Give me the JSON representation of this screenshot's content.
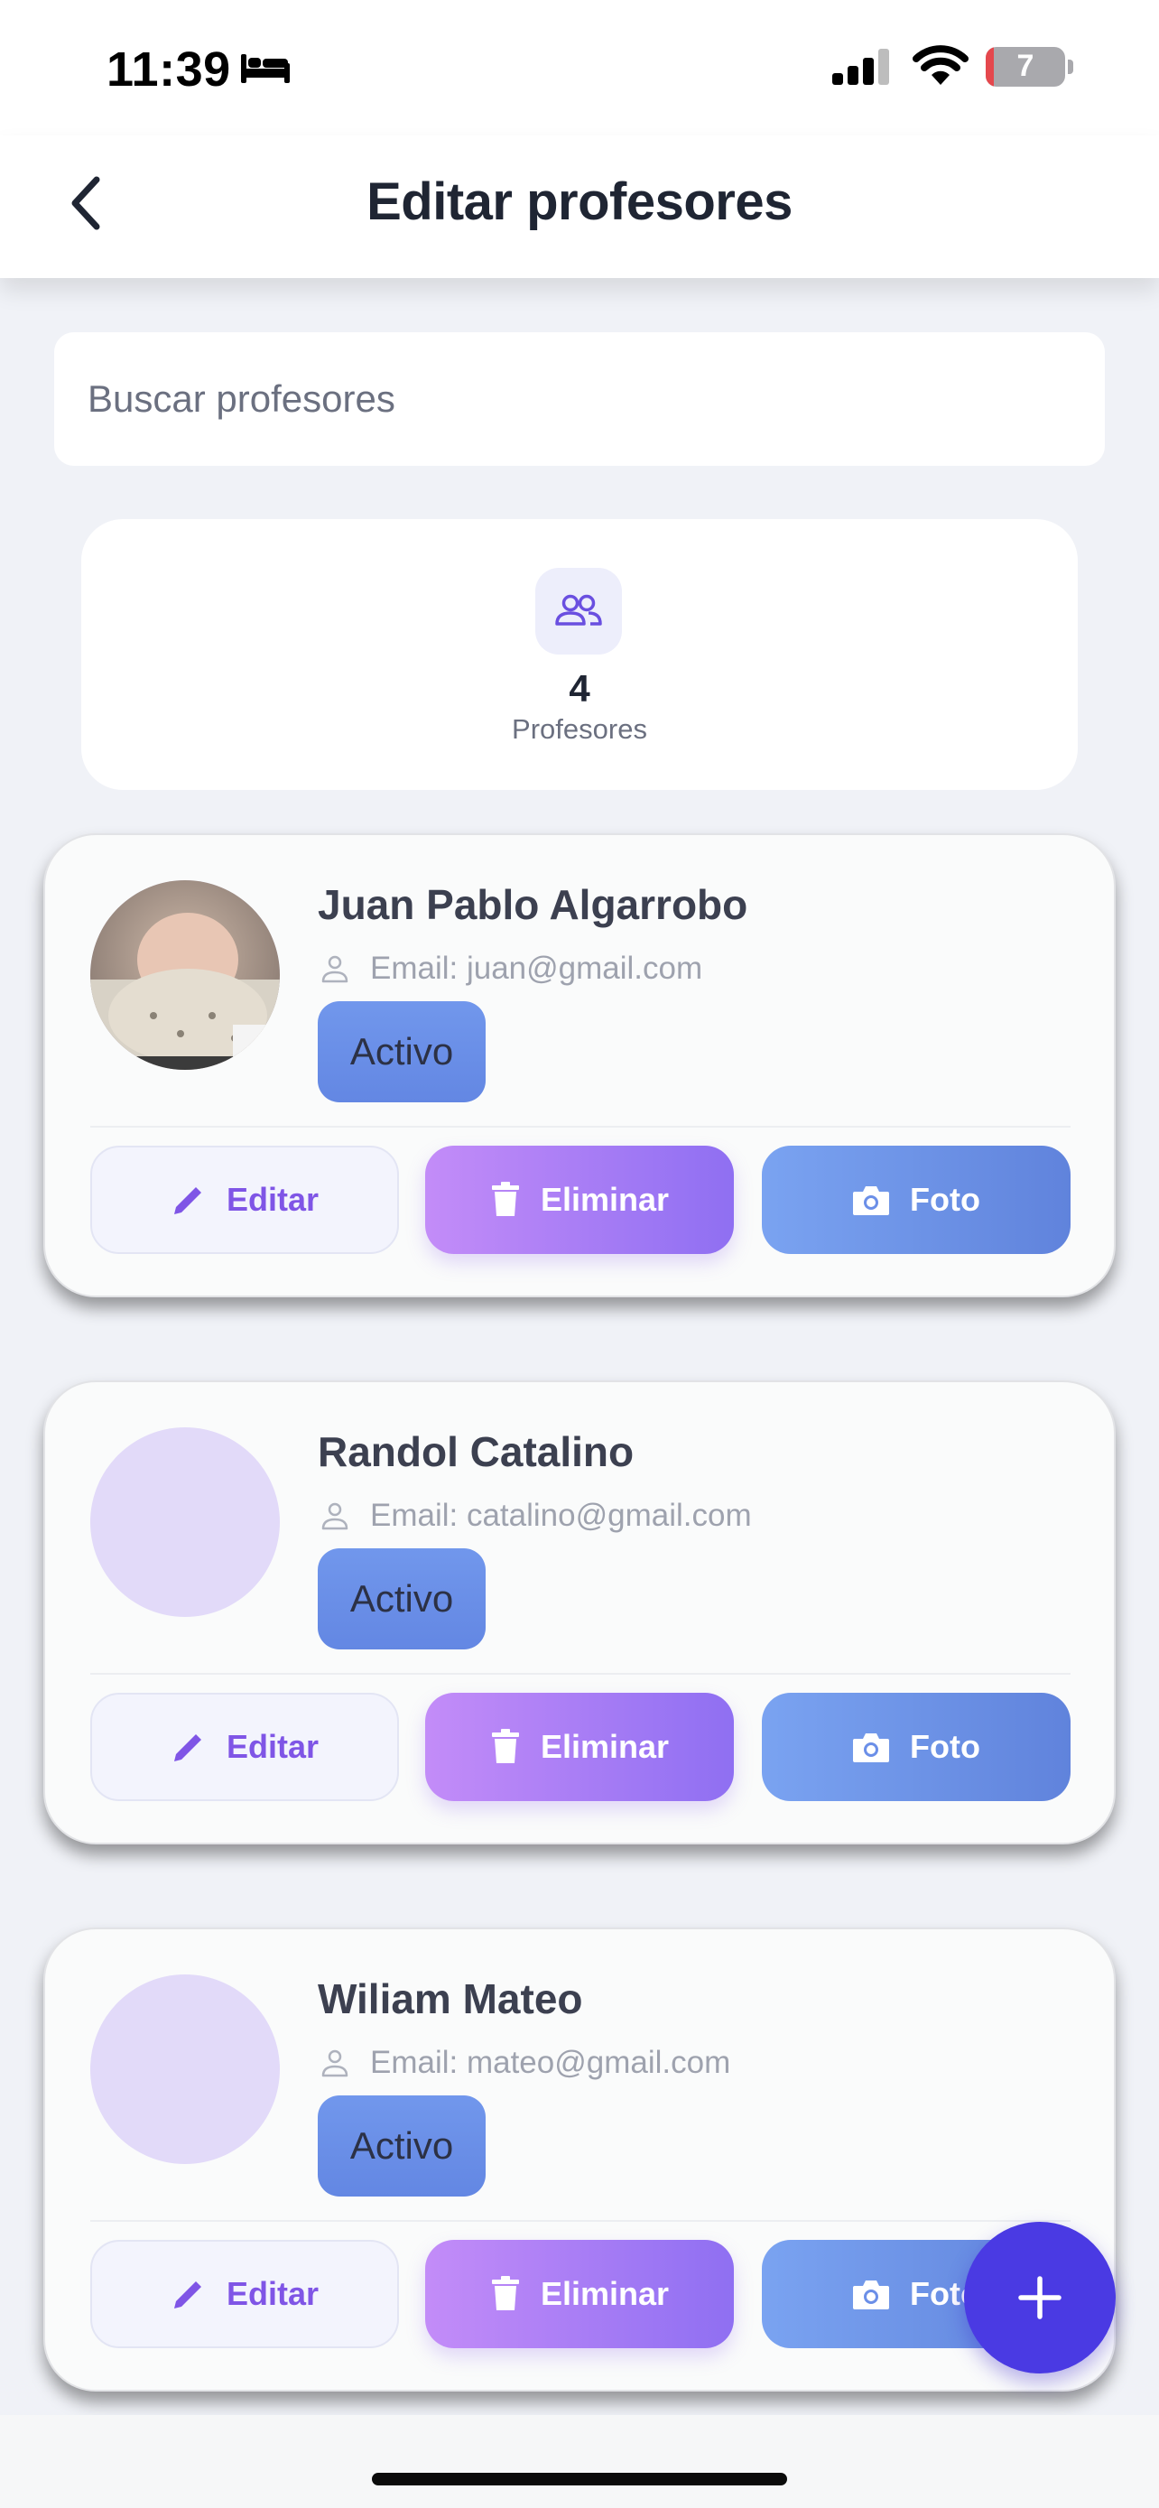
{
  "status_bar": {
    "time": "11:39",
    "battery_level": "7",
    "icons": [
      "bed-icon",
      "signal-icon",
      "wifi-icon",
      "battery-icon"
    ]
  },
  "header": {
    "title": "Editar profesores",
    "back_icon": "chevron-left-icon"
  },
  "search": {
    "placeholder": "Buscar profesores"
  },
  "stats": {
    "icon": "users-icon",
    "count": "4",
    "label": "Profesores"
  },
  "buttons": {
    "edit": "Editar",
    "delete": "Eliminar",
    "photo": "Foto"
  },
  "teachers": [
    {
      "name": "Juan Pablo Algarrobo",
      "email": "Email: juan@gmail.com",
      "status": "Activo",
      "has_photo": true
    },
    {
      "name": "Randol Catalino",
      "email": "Email: catalino@gmail.com",
      "status": "Activo",
      "has_photo": false
    },
    {
      "name": "Wiliam Mateo",
      "email": "Email: mateo@gmail.com",
      "status": "Activo",
      "has_photo": false
    }
  ],
  "fab": {
    "icon": "plus-icon"
  },
  "colors": {
    "accent": "#4a3ae3",
    "edit_text": "#7f55e6",
    "delete_gradient": [
      "#c38cf8",
      "#8f6ff2"
    ],
    "photo_gradient": [
      "#7aa3f1",
      "#6083dc"
    ],
    "status_badge": "#6b8fe8",
    "avatar_placeholder": "#e2daf9"
  }
}
